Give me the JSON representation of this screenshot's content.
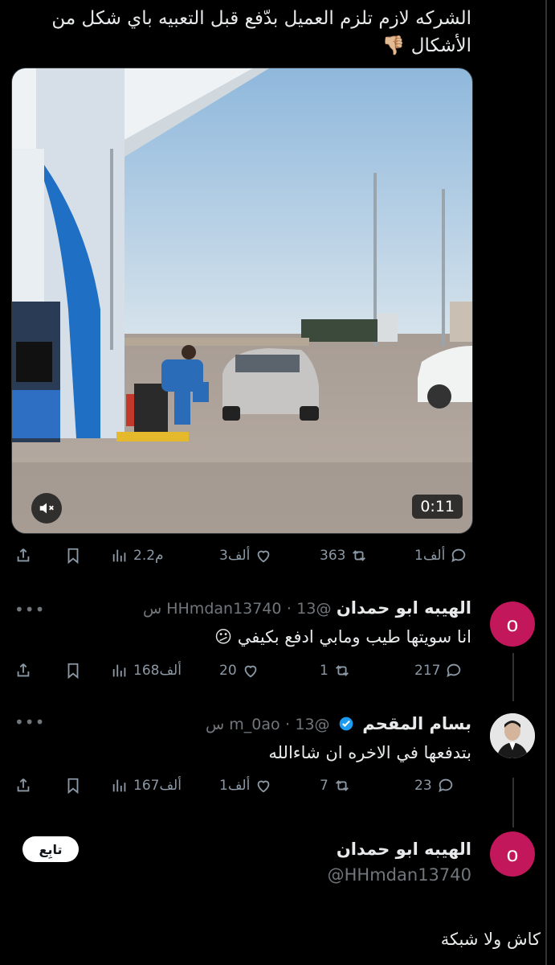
{
  "main_tweet": {
    "text": "الشركه لازم تلزم العميل بدّفع قبل التعبيه باي شكل من الأشكال 👎🏼",
    "video": {
      "duration": "0:11",
      "muted": true
    },
    "stats": {
      "replies": "1ألف",
      "retweets": "363",
      "likes": "3ألف",
      "views": "2.2م"
    }
  },
  "replies": [
    {
      "avatar_letter": "o",
      "avatar_color": "#c2185b",
      "name": "الهيبه ابو حمدان",
      "handle": "@HHmdan13740",
      "time": "13 س",
      "text": "انا سويتها طيب ومابي ادفع بكيفي 😕",
      "stats": {
        "replies": "217",
        "retweets": "1",
        "likes": "20",
        "views": "168ألف"
      }
    },
    {
      "name": "بسام المقحم",
      "handle": "@m_0ao",
      "time": "13 س",
      "verified": true,
      "text": "بتدفعها في الاخره ان شاءالله",
      "stats": {
        "replies": "23",
        "retweets": "7",
        "likes": "1ألف",
        "views": "167ألف"
      }
    }
  ],
  "profile_card": {
    "avatar_letter": "o",
    "name": "الهيبه ابو حمدان",
    "handle": "@HHmdan13740",
    "follow_label": "تابِع",
    "bio": "كاش ولا شبكة"
  },
  "colors": {
    "background": "#000000",
    "text": "#e7e9ea",
    "muted": "#71767b",
    "verified": "#1d9bf0",
    "avatar": "#c2185b"
  }
}
